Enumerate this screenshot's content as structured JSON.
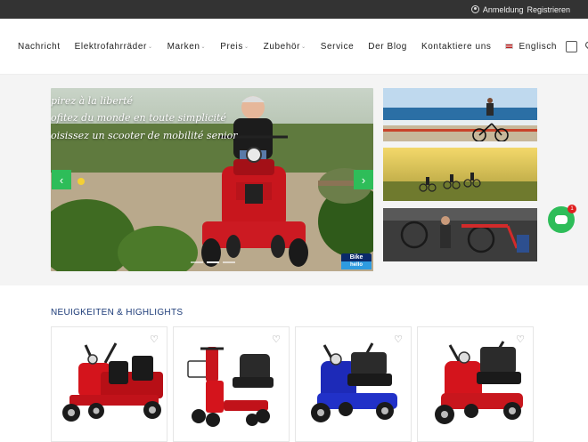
{
  "topbar": {
    "login": "Anmeldung",
    "register": "Registrieren"
  },
  "nav": {
    "items": [
      {
        "label": "Nachricht",
        "dropdown": false
      },
      {
        "label": "Elektrofahrräder",
        "dropdown": true
      },
      {
        "label": "Marken",
        "dropdown": true
      },
      {
        "label": "Preis",
        "dropdown": true
      },
      {
        "label": "Zubehör",
        "dropdown": true
      },
      {
        "label": "Service",
        "dropdown": false
      },
      {
        "label": "Der Blog",
        "dropdown": false
      },
      {
        "label": "Kontaktiere uns",
        "dropdown": false
      }
    ],
    "language": "Englisch",
    "icons": [
      "cart-icon",
      "heart-icon",
      "search-icon"
    ]
  },
  "hero": {
    "lines": [
      "pirez à la liberté",
      "ofitez du monde en toute simplicité",
      "oisissez un scooter de mobilité senior"
    ],
    "logo_text_top": "Bike",
    "logo_text_bottom": "hello",
    "prev_glyph": "‹",
    "next_glyph": "›",
    "slide_count": 3,
    "active_slide": 1
  },
  "chat": {
    "badge": "1"
  },
  "section": {
    "title": "NEUIGKEITEN & HIGHLIGHTS"
  },
  "products": [
    {
      "name": "red 4-wheel two-seat scooter",
      "color": "#d4141c"
    },
    {
      "name": "red folding travel scooter",
      "color": "#d4141c"
    },
    {
      "name": "blue 4-wheel mobility scooter",
      "color": "#1d2ab8"
    },
    {
      "name": "red 4-wheel mobility scooter",
      "color": "#d4141c"
    }
  ],
  "colors": {
    "topbar": "#333333",
    "accent_green": "#2ebd59",
    "section_title": "#1b3a77",
    "hero_bg": "#f4f4f4"
  }
}
